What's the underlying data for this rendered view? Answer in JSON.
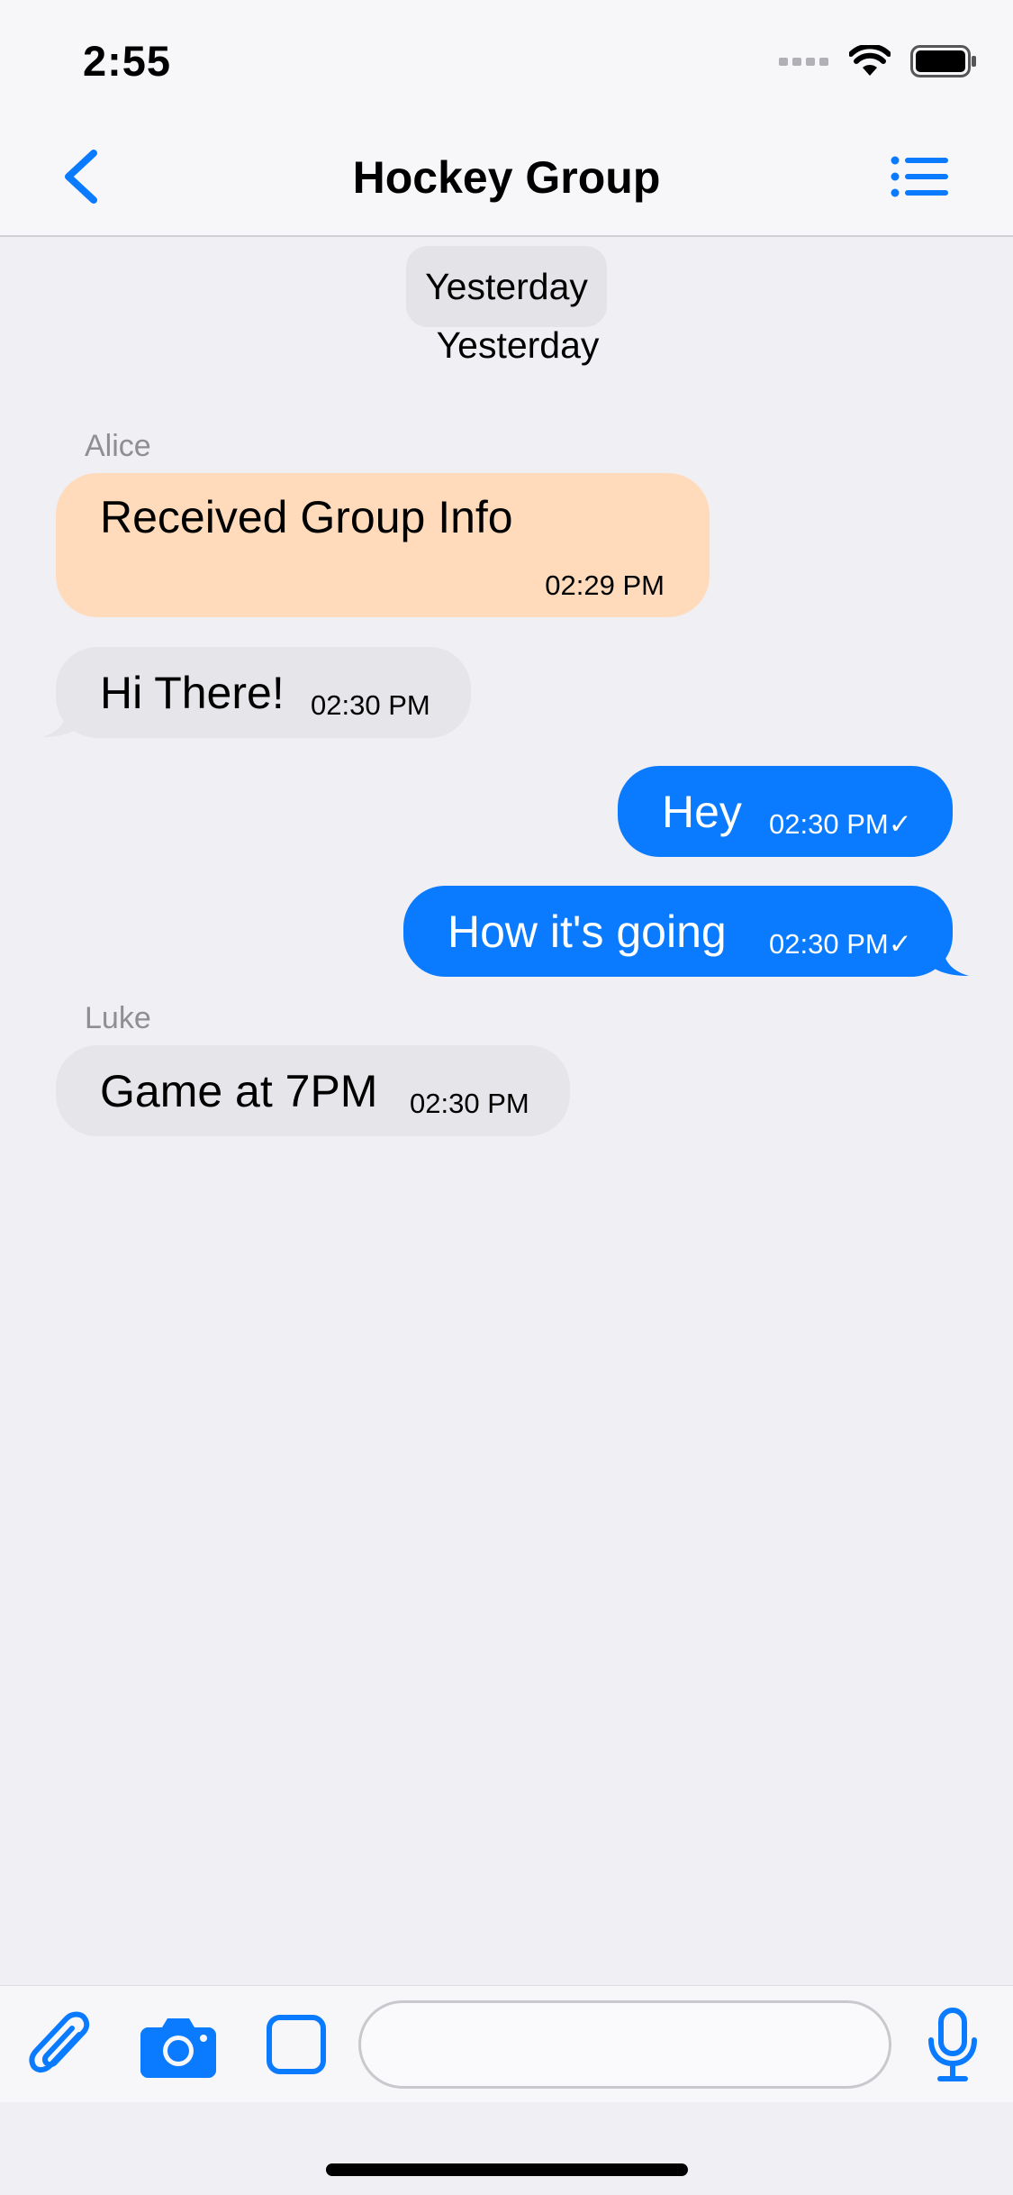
{
  "status_bar": {
    "time": "2:55"
  },
  "nav": {
    "title": "Hockey Group"
  },
  "chat": {
    "date_pill": "Yesterday",
    "date_sub": "Yesterday",
    "messages": [
      {
        "sender": "Alice",
        "text": "Received Group Info",
        "time": "02:29 PM",
        "direction": "incoming"
      },
      {
        "sender": "",
        "text": "Hi There!",
        "time": "02:30 PM",
        "direction": "incoming"
      },
      {
        "sender": "",
        "text": "Hey",
        "time": "02:30 PM✓",
        "direction": "outgoing"
      },
      {
        "sender": "",
        "text": "How it's going",
        "time": "02:30 PM✓",
        "direction": "outgoing"
      },
      {
        "sender": "Luke",
        "text": "Game at 7PM",
        "time": "02:30 PM",
        "direction": "incoming"
      }
    ]
  },
  "toolbar": {
    "input_value": "",
    "input_placeholder": ""
  },
  "colors": {
    "accent": "#0a7aff",
    "incoming_bubble": "#e5e5ea",
    "highlight_bubble": "#ffdbbb",
    "background": "#efeff4"
  },
  "icons": [
    "chevron-left-icon",
    "list-icon",
    "paperclip-icon",
    "camera-icon",
    "square-icon",
    "microphone-icon",
    "wifi-icon",
    "battery-icon",
    "signal-icon"
  ]
}
